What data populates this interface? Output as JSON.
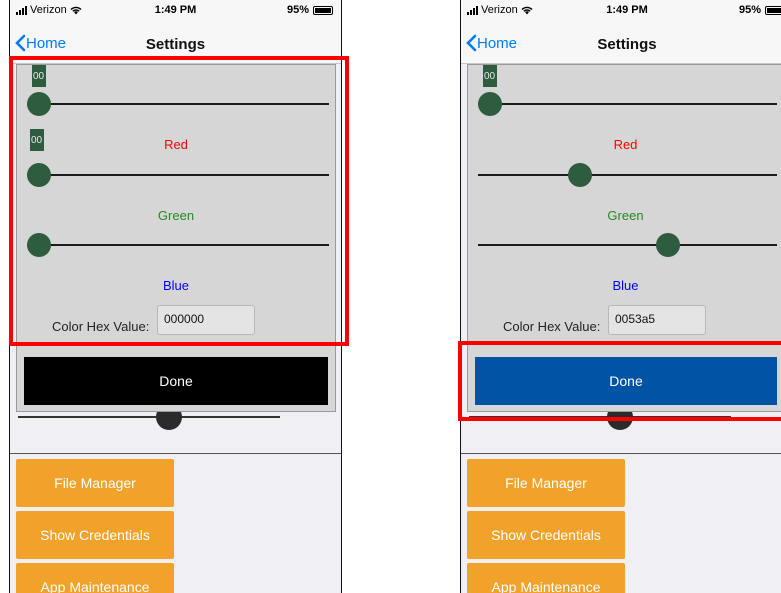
{
  "status_bar": {
    "carrier": "Verizon",
    "time": "1:49 PM",
    "battery": "95%"
  },
  "nav": {
    "back_label": "Home",
    "title": "Settings"
  },
  "menu": {
    "file_manager": "File Manager",
    "show_credentials": "Show Credentials",
    "app_maintenance": "App Maintenance"
  },
  "left": {
    "sliders": {
      "red_value": 0,
      "green_value": 0,
      "blue_value": 0,
      "max": 255
    },
    "badges": {
      "top": "00",
      "middle": "00"
    },
    "labels": {
      "red": "Red",
      "green": "Green",
      "blue": "Blue"
    },
    "hex_label": "Color Hex Value:",
    "hex_value": "000000",
    "done_label": "Done",
    "done_color": "#000000"
  },
  "right": {
    "sliders": {
      "red_value": 0,
      "green_value": 83,
      "blue_value": 165,
      "max": 255
    },
    "badges": {
      "top": "00"
    },
    "labels": {
      "red": "Red",
      "green": "Green",
      "blue": "Blue"
    },
    "hex_label": "Color Hex Value:",
    "hex_value": "0053a5",
    "done_label": "Done",
    "done_color": "#0053a5"
  },
  "colors": {
    "red_label": "#ff0000",
    "green_label": "#228b22",
    "blue_label": "#0000ff",
    "highlight": "#ff0000",
    "menu_button": "#f0a22b"
  }
}
